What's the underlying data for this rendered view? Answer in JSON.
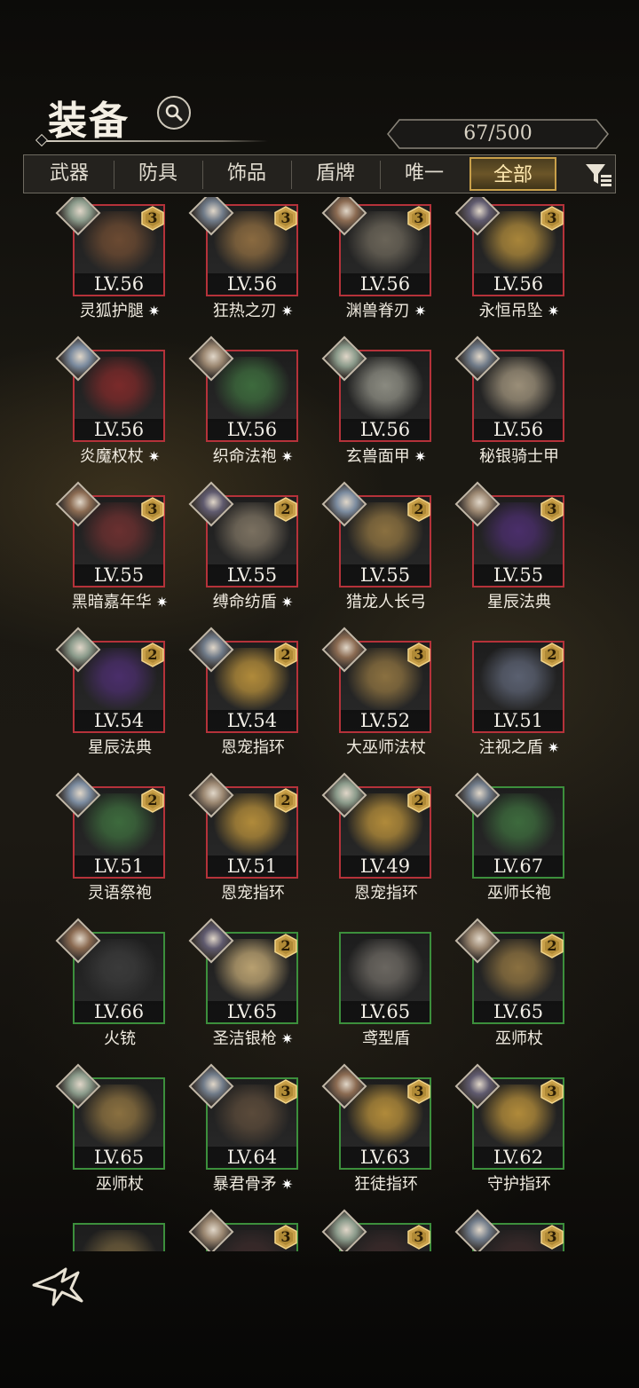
{
  "header": {
    "title": "装备",
    "capacity": "67/500"
  },
  "tabs": [
    {
      "label": "武器",
      "active": false
    },
    {
      "label": "防具",
      "active": false
    },
    {
      "label": "饰品",
      "active": false
    },
    {
      "label": "盾牌",
      "active": false
    },
    {
      "label": "唯一",
      "active": false
    },
    {
      "label": "全部",
      "active": true
    }
  ],
  "colors": {
    "red_frame": "#b5323a",
    "green_frame": "#3c8f3c",
    "gold": "#c9a04a"
  },
  "items": [
    {
      "name": "灵狐护腿",
      "level": "LV.56",
      "rank": "3",
      "frame": "red",
      "enhanced": true,
      "icon": "boots-icon"
    },
    {
      "name": "狂热之刃",
      "level": "LV.56",
      "rank": "3",
      "frame": "red",
      "enhanced": true,
      "icon": "sword-icon"
    },
    {
      "name": "渊兽脊刃",
      "level": "LV.56",
      "rank": "3",
      "frame": "red",
      "enhanced": true,
      "icon": "claw-blade-icon"
    },
    {
      "name": "永恒吊坠",
      "level": "LV.56",
      "rank": "3",
      "frame": "red",
      "enhanced": true,
      "icon": "amulet-icon"
    },
    {
      "name": "炎魔权杖",
      "level": "LV.56",
      "rank": "",
      "frame": "red",
      "enhanced": true,
      "icon": "scepter-icon"
    },
    {
      "name": "织命法袍",
      "level": "LV.56",
      "rank": "",
      "frame": "red",
      "enhanced": true,
      "icon": "robe-icon"
    },
    {
      "name": "玄兽面甲",
      "level": "LV.56",
      "rank": "",
      "frame": "red",
      "enhanced": true,
      "icon": "mask-icon"
    },
    {
      "name": "秘银骑士甲",
      "level": "LV.56",
      "rank": "",
      "frame": "red",
      "enhanced": false,
      "icon": "armor-icon"
    },
    {
      "name": "黑暗嘉年华",
      "level": "LV.55",
      "rank": "3",
      "frame": "red",
      "enhanced": true,
      "icon": "hammer-icon"
    },
    {
      "name": "缚命纺盾",
      "level": "LV.55",
      "rank": "2",
      "frame": "red",
      "enhanced": true,
      "icon": "web-shield-icon"
    },
    {
      "name": "猎龙人长弓",
      "level": "LV.55",
      "rank": "2",
      "frame": "red",
      "enhanced": false,
      "icon": "bow-icon"
    },
    {
      "name": "星辰法典",
      "level": "LV.55",
      "rank": "3",
      "frame": "red",
      "enhanced": false,
      "icon": "tome-icon"
    },
    {
      "name": "星辰法典",
      "level": "LV.54",
      "rank": "2",
      "frame": "red",
      "enhanced": false,
      "icon": "tome-icon"
    },
    {
      "name": "恩宠指环",
      "level": "LV.54",
      "rank": "2",
      "frame": "red",
      "enhanced": false,
      "icon": "ring-icon"
    },
    {
      "name": "大巫师法杖",
      "level": "LV.52",
      "rank": "3",
      "frame": "red",
      "enhanced": false,
      "icon": "staff-icon"
    },
    {
      "name": "注视之盾",
      "level": "LV.51",
      "rank": "2",
      "frame": "red",
      "enhanced": true,
      "icon": "eye-shield-icon"
    },
    {
      "name": "灵语祭袍",
      "level": "LV.51",
      "rank": "2",
      "frame": "red",
      "enhanced": false,
      "icon": "robe-icon"
    },
    {
      "name": "恩宠指环",
      "level": "LV.51",
      "rank": "2",
      "frame": "red",
      "enhanced": false,
      "icon": "ring-icon"
    },
    {
      "name": "恩宠指环",
      "level": "LV.49",
      "rank": "2",
      "frame": "red",
      "enhanced": false,
      "icon": "ring-icon"
    },
    {
      "name": "巫师长袍",
      "level": "LV.67",
      "rank": "",
      "frame": "green",
      "enhanced": false,
      "icon": "robe-icon"
    },
    {
      "name": "火铳",
      "level": "LV.66",
      "rank": "",
      "frame": "green",
      "enhanced": false,
      "icon": "gun-icon"
    },
    {
      "name": "圣洁银枪",
      "level": "LV.65",
      "rank": "2",
      "frame": "green",
      "enhanced": true,
      "icon": "spear-icon"
    },
    {
      "name": "鸢型盾",
      "level": "LV.65",
      "rank": "",
      "frame": "green",
      "enhanced": false,
      "icon": "kite-shield-icon"
    },
    {
      "name": "巫师杖",
      "level": "LV.65",
      "rank": "2",
      "frame": "green",
      "enhanced": false,
      "icon": "staff-icon"
    },
    {
      "name": "巫师杖",
      "level": "LV.65",
      "rank": "",
      "frame": "green",
      "enhanced": false,
      "icon": "staff-icon"
    },
    {
      "name": "暴君骨矛",
      "level": "LV.64",
      "rank": "3",
      "frame": "green",
      "enhanced": true,
      "icon": "bone-spear-icon"
    },
    {
      "name": "狂徒指环",
      "level": "LV.63",
      "rank": "3",
      "frame": "green",
      "enhanced": false,
      "icon": "ring-icon"
    },
    {
      "name": "守护指环",
      "level": "LV.62",
      "rank": "3",
      "frame": "green",
      "enhanced": false,
      "icon": "ring-icon"
    },
    {
      "name": "",
      "level": "",
      "rank": "",
      "frame": "green",
      "enhanced": false,
      "icon": "helmet-icon"
    },
    {
      "name": "",
      "level": "",
      "rank": "3",
      "frame": "green",
      "enhanced": false,
      "icon": "hood-icon"
    },
    {
      "name": "",
      "level": "",
      "rank": "3",
      "frame": "green",
      "enhanced": false,
      "icon": "hood-icon"
    },
    {
      "name": "",
      "level": "",
      "rank": "3",
      "frame": "green",
      "enhanced": false,
      "icon": "hood-icon"
    }
  ]
}
